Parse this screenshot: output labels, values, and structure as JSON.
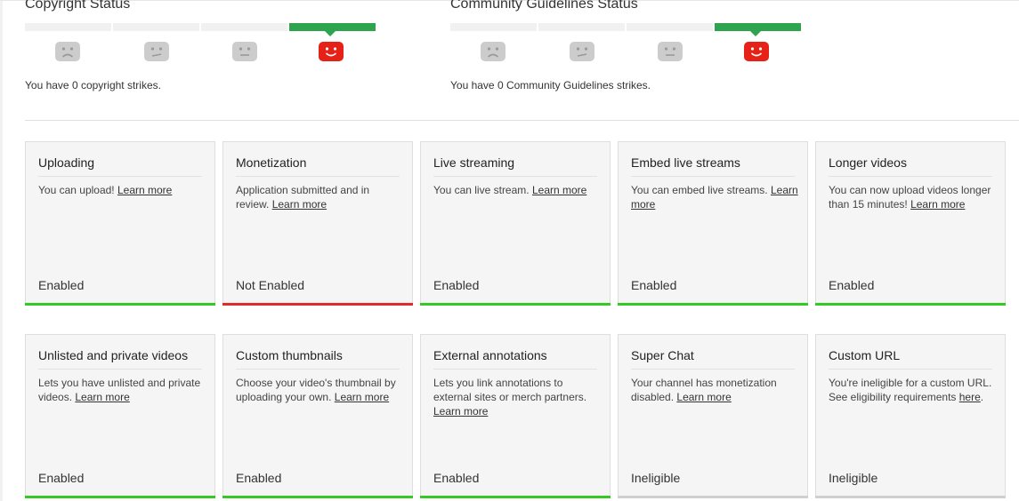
{
  "copyright": {
    "title": "Copyright Status",
    "text": "You have 0 copyright strikes."
  },
  "community": {
    "title": "Community Guidelines Status",
    "text": "You have 0 Community Guidelines strikes."
  },
  "colors": {
    "enabled": "#34c924",
    "not_enabled": "#de2b2b",
    "ineligible": "#d0d0d0",
    "meter_active": "#2ea44f",
    "face_active": "#e62117",
    "face_inactive": "#cccccc"
  },
  "features": [
    {
      "title": "Uploading",
      "desc": "You can upload!",
      "link": "Learn more",
      "status": "Enabled",
      "state": "enabled"
    },
    {
      "title": "Monetization",
      "desc": "Application submitted and in review.",
      "link": "Learn more",
      "status": "Not Enabled",
      "state": "not_enabled"
    },
    {
      "title": "Live streaming",
      "desc": "You can live stream.",
      "link": "Learn more",
      "status": "Enabled",
      "state": "enabled"
    },
    {
      "title": "Embed live streams",
      "desc": "You can embed live streams.",
      "link": "Learn more",
      "status": "Enabled",
      "state": "enabled"
    },
    {
      "title": "Longer videos",
      "desc": "You can now upload videos longer than 15 minutes!",
      "link": "Learn more",
      "status": "Enabled",
      "state": "enabled"
    },
    {
      "title": "Unlisted and private videos",
      "desc": "Lets you have unlisted and private videos.",
      "link": "Learn more",
      "status": "Enabled",
      "state": "enabled"
    },
    {
      "title": "Custom thumbnails",
      "desc": "Choose your video's thumbnail by uploading your own.",
      "link": "Learn more",
      "status": "Enabled",
      "state": "enabled"
    },
    {
      "title": "External annotations",
      "desc": "Lets you link annotations to external sites or merch partners.",
      "link": "Learn more",
      "status": "Enabled",
      "state": "enabled"
    },
    {
      "title": "Super Chat",
      "desc": "Your channel has monetization disabled.",
      "link": "Learn more",
      "status": "Ineligible",
      "state": "ineligible"
    },
    {
      "title": "Custom URL",
      "desc": "You're ineligible for a custom URL. See eligibility requirements",
      "link": "here",
      "tail": ".",
      "status": "Ineligible",
      "state": "ineligible"
    }
  ]
}
